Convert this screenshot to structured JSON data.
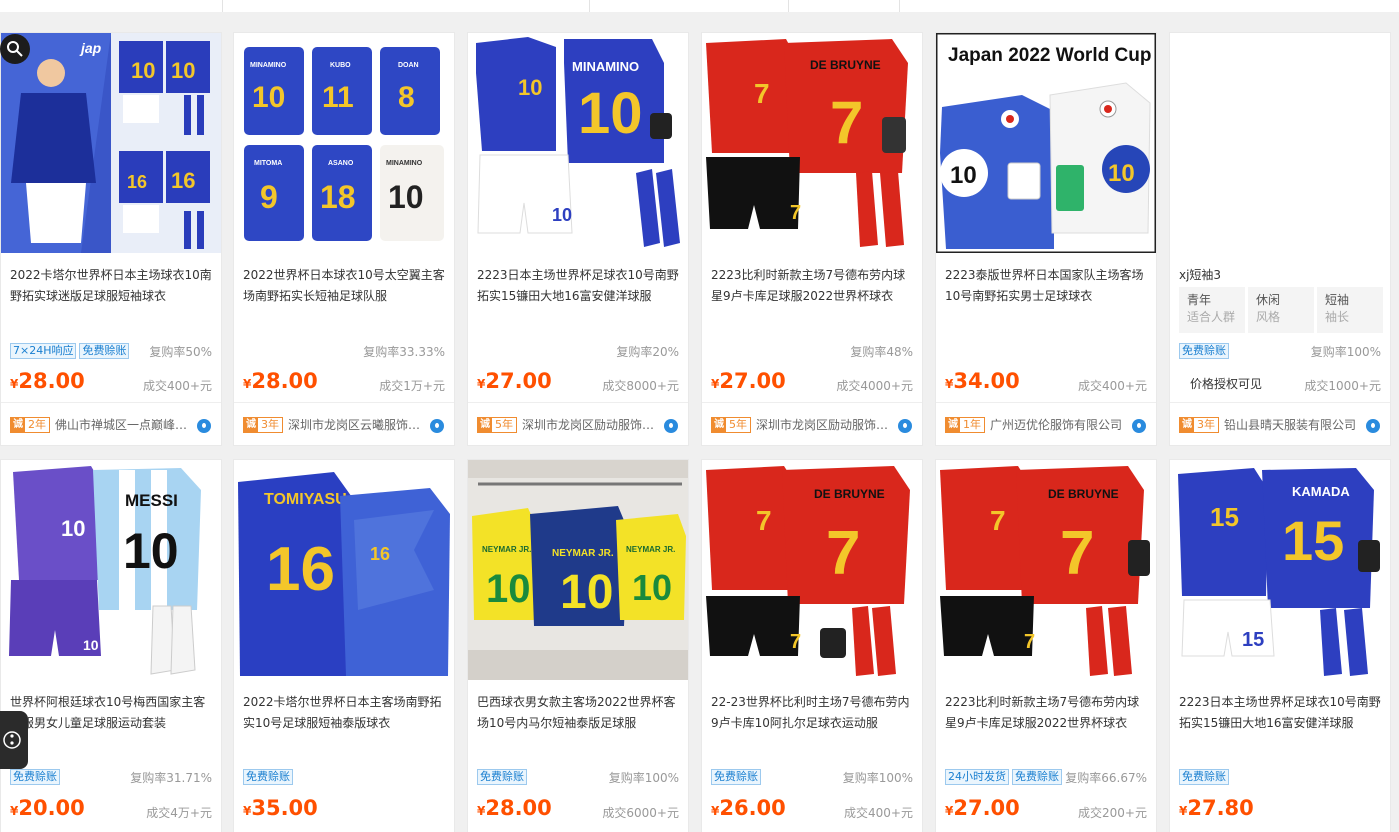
{
  "products": [
    {
      "title": "2022卡塔尔世界杯日本主场球衣10南野拓实球迷版足球服短袖球衣",
      "tags": [
        "7×24H响应",
        "免费赊账"
      ],
      "repurchase": "复购率50%",
      "currency": "¥",
      "price": "28.00",
      "deal": "成交400+元",
      "badge_icon": "诚",
      "years": "2年",
      "shop": "佛山市禅城区一点巅峰服饰商行"
    },
    {
      "title": "2022世界杯日本球衣10号太空翼主客场南野拓实长短袖足球队服",
      "tags": [],
      "repurchase": "复购率33.33%",
      "currency": "¥",
      "price": "28.00",
      "deal": "成交1万+元",
      "badge_icon": "诚",
      "years": "3年",
      "shop": "深圳市龙岗区云曦服饰商行"
    },
    {
      "title": "2223日本主场世界杯足球衣10号南野拓实15镰田大地16富安健洋球服",
      "tags": [],
      "repurchase": "复购率20%",
      "currency": "¥",
      "price": "27.00",
      "deal": "成交8000+元",
      "badge_icon": "诚",
      "years": "5年",
      "shop": "深圳市龙岗区励动服饰商行"
    },
    {
      "title": "2223比利时新款主场7号德布劳内球星9卢卡库足球服2022世界杯球衣",
      "tags": [],
      "repurchase": "复购率48%",
      "currency": "¥",
      "price": "27.00",
      "deal": "成交4000+元",
      "badge_icon": "诚",
      "years": "5年",
      "shop": "深圳市龙岗区励动服饰商行"
    },
    {
      "title": "2223泰版世界杯日本国家队主场客场10号南野拓实男士足球球衣",
      "tags": [],
      "repurchase": "",
      "currency": "¥",
      "price": "34.00",
      "deal": "成交400+元",
      "badge_icon": "诚",
      "years": "1年",
      "shop": "广州迈优伦服饰有限公司",
      "image_text": "Japan 2022 World Cup"
    },
    {
      "title": "xj短袖3",
      "attrs": [
        {
          "k": "青年",
          "v": "适合人群"
        },
        {
          "k": "休闲",
          "v": "风格"
        },
        {
          "k": "短袖",
          "v": "袖长"
        }
      ],
      "tags": [
        "免费赊账"
      ],
      "repurchase": "复购率100%",
      "price_text": "价格授权可见",
      "deal": "成交1000+元",
      "badge_icon": "诚",
      "years": "3年",
      "shop": "铅山县晴天服装有限公司"
    },
    {
      "title": "世界杯阿根廷球衣10号梅西国家主客队服男女儿童足球服运动套装",
      "tags": [
        "免费赊账"
      ],
      "repurchase": "复购率31.71%",
      "currency": "¥",
      "price": "20.00",
      "deal": "成交4万+元"
    },
    {
      "title": "2022卡塔尔世界杯日本主客场南野拓实10号足球服短袖泰版球衣",
      "tags": [
        "免费赊账"
      ],
      "repurchase": "",
      "currency": "¥",
      "price": "35.00",
      "deal": ""
    },
    {
      "title": "巴西球衣男女款主客场2022世界杯客场10号内马尔短袖泰版足球服",
      "tags": [
        "免费赊账"
      ],
      "repurchase": "复购率100%",
      "currency": "¥",
      "price": "28.00",
      "deal": "成交6000+元"
    },
    {
      "title": "22-23世界杯比利时主场7号德布劳内9卢卡库10阿扎尔足球衣运动服",
      "tags": [
        "免费赊账"
      ],
      "repurchase": "复购率100%",
      "currency": "¥",
      "price": "26.00",
      "deal": "成交400+元"
    },
    {
      "title": "2223比利时新款主场7号德布劳内球星9卢卡库足球服2022世界杯球衣",
      "tags": [
        "24小时发货",
        "免费赊账"
      ],
      "repurchase": "复购率66.67%",
      "currency": "¥",
      "price": "27.00",
      "deal": "成交200+元"
    },
    {
      "title": "2223日本主场世界杯足球衣10号南野拓实15镰田大地16富安健洋球服",
      "tags": [
        "免费赊账"
      ],
      "repurchase": "",
      "currency": "¥",
      "price": "27.80",
      "deal": ""
    }
  ],
  "jersey_names": {
    "p2": [
      "MINAMINO",
      "KUBO",
      "DOAN",
      "MITOMA",
      "ASANO",
      "MINAMINO"
    ],
    "p3": "MINAMINO",
    "p4": "DE BRUYNE",
    "p7": "MESSI",
    "p8": "TOMIYASU",
    "p9": [
      "NEYMAR JR.",
      "NEYMAR JR.",
      "NEYMAR JR."
    ],
    "p10": "DE BRUYNE",
    "p11": "DE BRUYNE",
    "p12": "KAMADA"
  },
  "colors": {
    "price": "#ff5000",
    "tag_blue": "#1a7fd0",
    "badge_orange": "#f08c30",
    "japan_blue": "#2638a8",
    "belgium_red": "#d9271c"
  },
  "icons": [
    "search-icon",
    "share-icon",
    "wangwang-icon"
  ]
}
